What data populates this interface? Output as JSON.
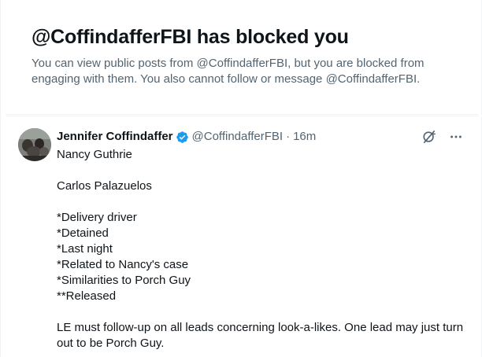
{
  "blocked": {
    "title": "@CoffindafferFBI has blocked you",
    "description": "You can view public posts from @CoffindafferFBI, but you are blocked from engaging with them. You also cannot follow or message @CoffindafferFBI."
  },
  "tweet": {
    "author_name": "Jennifer Coffindaffer",
    "handle": "@CoffindafferFBI",
    "separator": "·",
    "time": "16m",
    "icons": {
      "verified": "verified-badge-icon",
      "grok": "grok-icon",
      "more": "more-icon"
    },
    "lines": {
      "l1": "Nancy Guthrie",
      "l2": "Carlos Palazuelos",
      "l3": "*Delivery driver",
      "l4": "*Detained",
      "l5": "*Last night",
      "l6": "*Related to Nancy's case",
      "l7": "*Similarities to Porch Guy",
      "l8": "**Released",
      "l9": "LE must follow-up on all leads concerning look-a-likes.  One lead may just turn out to be Porch Guy."
    }
  },
  "colors": {
    "primary_text": "#0f1419",
    "secondary_text": "#536471",
    "verified_blue": "#1d9bf0",
    "border": "#eff3f4"
  }
}
